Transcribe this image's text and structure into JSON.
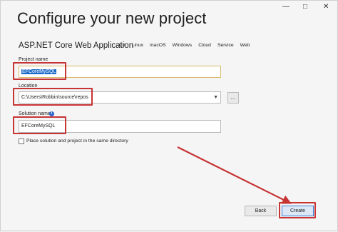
{
  "window": {
    "minimize": "—",
    "maximize": "□",
    "close": "✕",
    "title": "Configure your new project"
  },
  "template": {
    "name": "ASP.NET Core Web Application",
    "tags": [
      "C#",
      "Linux",
      "macOS",
      "Windows",
      "Cloud",
      "Service",
      "Web"
    ]
  },
  "form": {
    "project_name_label": "Project name",
    "project_name_value": "EFCoreMySQL",
    "location_label": "Location",
    "location_value": "C:\\Users\\Robbin\\source\\repos",
    "browse_label": "...",
    "solution_name_label": "Solution name",
    "solution_info": "i",
    "solution_name_value": "EFCoreMySQL",
    "same_directory_label": "Place solution and project in the same directory",
    "same_directory_checked": false
  },
  "buttons": {
    "back": "Back",
    "create": "Create"
  },
  "annotation_color": "#c73434"
}
